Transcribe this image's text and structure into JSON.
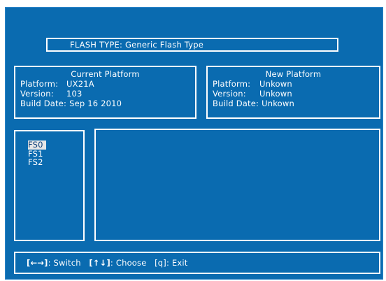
{
  "flash_type": {
    "label": "FLASH TYPE:",
    "value": "Generic Flash Type"
  },
  "current_platform": {
    "title": "Current Platform",
    "platform_label": "Platform:",
    "platform_value": "UX21A",
    "version_label": "Version:",
    "version_value": "103",
    "build_date_label": "Build Date:",
    "build_date_value": "Sep 16 2010"
  },
  "new_platform": {
    "title": "New Platform",
    "platform_label": "Platform:",
    "platform_value": "Unkown",
    "version_label": "Version:",
    "version_value": "Unkown",
    "build_date_label": "Build Date:",
    "build_date_value": "Unkown"
  },
  "file_systems": {
    "items": [
      "FS0",
      "FS1",
      "FS2"
    ],
    "selected": "FS0"
  },
  "status_bar": {
    "switch_keys": "[←→]",
    "switch_label": ": Switch",
    "choose_keys": "[↑↓]",
    "choose_label": ": Choose",
    "exit_keys": "[q]",
    "exit_label": ": Exit"
  },
  "colors": {
    "background": "#0a6bb0",
    "foreground": "#ffffff",
    "selection_background": "#e6e6e6",
    "selection_foreground": "#0a3f7a"
  }
}
